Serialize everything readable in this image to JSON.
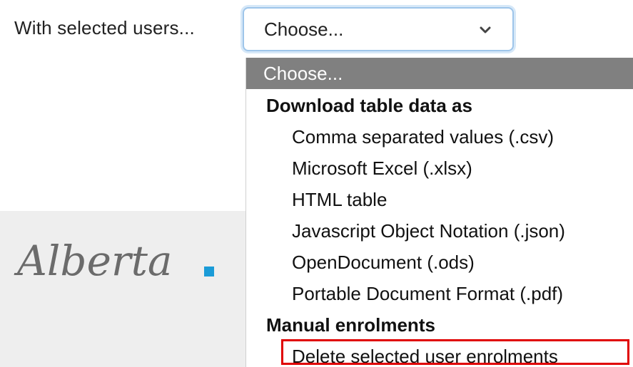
{
  "form": {
    "label": "With selected users...",
    "select_value": "Choose..."
  },
  "dropdown": {
    "selected_option": "Choose...",
    "groups": [
      {
        "label": "Download table data as",
        "items": [
          "Comma separated values (.csv)",
          "Microsoft Excel (.xlsx)",
          "HTML table",
          "Javascript Object Notation (.json)",
          "OpenDocument (.ods)",
          "Portable Document Format (.pdf)"
        ]
      },
      {
        "label": "Manual enrolments",
        "items": [
          "Delete selected user enrolments"
        ]
      }
    ]
  },
  "branding": {
    "logo_text": "Alberta",
    "logo_icon": "alberta-square-icon",
    "accent_color": "#1a9bd7",
    "logo_text_color": "#6b6b6b"
  },
  "colors": {
    "highlight_border": "#e00000",
    "selected_bg": "#808080",
    "focus_border": "#9ec5ea"
  }
}
